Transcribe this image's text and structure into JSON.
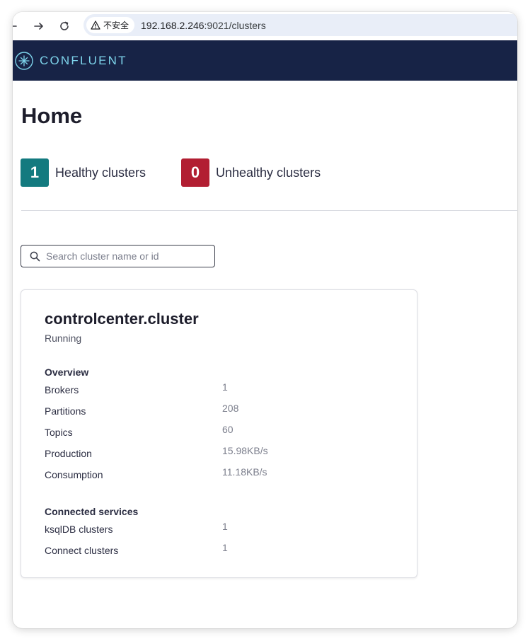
{
  "browser": {
    "security_label": "不安全",
    "url_host": "192.168.2.246",
    "url_rest": ":9021/clusters"
  },
  "header": {
    "brand": "CONFLUENT"
  },
  "page": {
    "title": "Home"
  },
  "summary": {
    "healthy": {
      "count": "1",
      "label": "Healthy clusters",
      "color": "#137a7f"
    },
    "unhealthy": {
      "count": "0",
      "label": "Unhealthy clusters",
      "color": "#b21e32"
    }
  },
  "search": {
    "placeholder": "Search cluster name or id",
    "value": ""
  },
  "cluster": {
    "name": "controlcenter.cluster",
    "status": "Running",
    "overview_title": "Overview",
    "overview": [
      {
        "label": "Brokers",
        "value": "1"
      },
      {
        "label": "Partitions",
        "value": "208"
      },
      {
        "label": "Topics",
        "value": "60"
      },
      {
        "label": "Production",
        "value": "15.98KB/s"
      },
      {
        "label": "Consumption",
        "value": "11.18KB/s"
      }
    ],
    "services_title": "Connected services",
    "services": [
      {
        "label": "ksqlDB clusters",
        "value": "1"
      },
      {
        "label": "Connect clusters",
        "value": "1"
      }
    ]
  }
}
